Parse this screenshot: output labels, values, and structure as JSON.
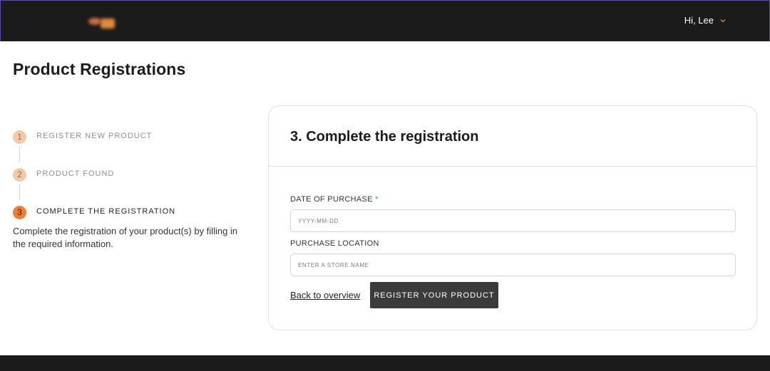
{
  "header": {
    "greeting": "Hi, Lee",
    "chevron_color": "#e08a3e",
    "logo_icon": "brand-logo"
  },
  "page": {
    "title": "Product Registrations"
  },
  "stepper": {
    "steps": [
      {
        "number": "1",
        "label": "REGISTER NEW PRODUCT",
        "state": "done"
      },
      {
        "number": "2",
        "label": "PRODUCT FOUND",
        "state": "done"
      },
      {
        "number": "3",
        "label": "COMPLETE THE REGISTRATION",
        "state": "active"
      }
    ],
    "description": "Complete the registration of your product(s) by filling in the required information."
  },
  "form": {
    "title": "3. Complete the registration",
    "date_label": "DATE OF PURCHASE",
    "required_mark": "*",
    "date_placeholder": "YYYY-MM-DD",
    "date_value": "",
    "location_label": "PURCHASE LOCATION",
    "location_placeholder": "ENTER A STORE NAME",
    "location_value": "",
    "back_label": "Back to overview",
    "submit_label": "REGISTER YOUR PRODUCT"
  },
  "colors": {
    "topbar": "#1c1b1c",
    "step_done": "#f3c9a8",
    "step_active": "#ed7f33",
    "button": "#3b3b3b",
    "required": "#2fa37a"
  }
}
